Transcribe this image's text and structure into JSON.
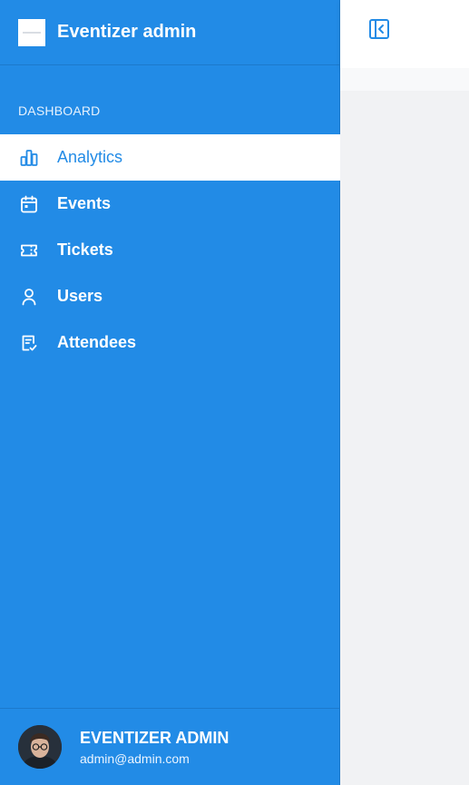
{
  "brand": {
    "title": "Eventizer admin"
  },
  "nav": {
    "section_label": "DASHBOARD",
    "items": [
      {
        "label": "Analytics",
        "icon": "bar-chart-icon",
        "active": true
      },
      {
        "label": "Events",
        "icon": "calendar-icon",
        "active": false
      },
      {
        "label": "Tickets",
        "icon": "ticket-icon",
        "active": false
      },
      {
        "label": "Users",
        "icon": "user-icon",
        "active": false
      },
      {
        "label": "Attendees",
        "icon": "checklist-icon",
        "active": false
      }
    ]
  },
  "user": {
    "name": "EVENTIZER ADMIN",
    "email": "admin@admin.com"
  },
  "header": {
    "toggle_icon": "sidebar-collapse-icon"
  },
  "colors": {
    "sidebar_bg": "#228be6",
    "active_bg": "#ffffff",
    "active_text": "#228be6",
    "content_bg": "#f1f2f4"
  }
}
